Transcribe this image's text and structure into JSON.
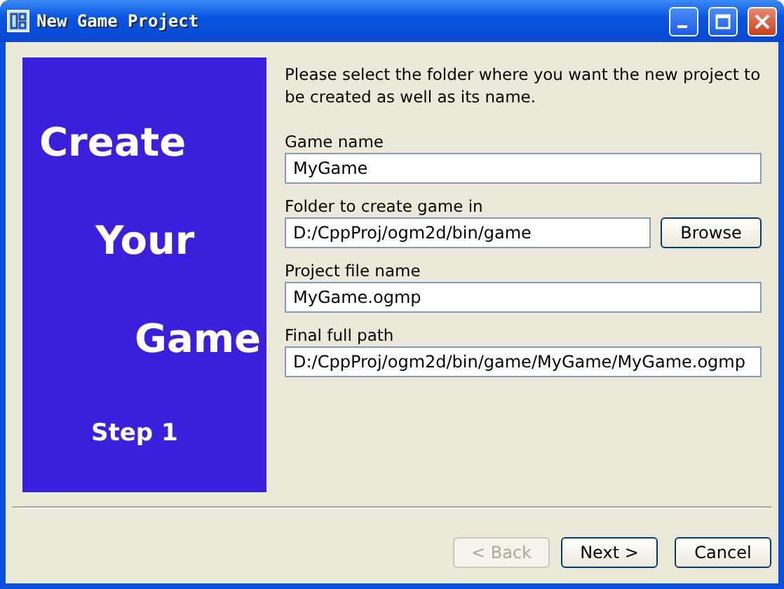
{
  "window": {
    "title": "New Game Project"
  },
  "banner": {
    "lines": [
      "Create",
      "Your",
      "Game"
    ],
    "step": "Step 1"
  },
  "intro": "Please select the folder where you want the new project to be created as well as its name.",
  "fields": [
    {
      "label": "Game name",
      "value": "MyGame"
    },
    {
      "label": "Folder to create game in",
      "value": "D:/CppProj/ogm2d/bin/game",
      "button": "Browse"
    },
    {
      "label": "Project file name",
      "value": "MyGame.ogmp"
    },
    {
      "label": "Final full path",
      "value": "D:/CppProj/ogm2d/bin/game/MyGame/MyGame.ogmp"
    }
  ],
  "buttons": [
    {
      "label": "< Back",
      "disabled": true
    },
    {
      "label": "Next >",
      "disabled": false
    },
    {
      "label": "Cancel",
      "disabled": false
    }
  ]
}
